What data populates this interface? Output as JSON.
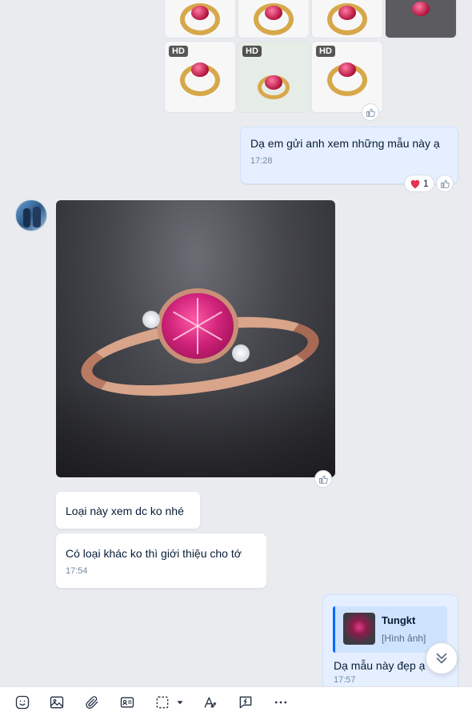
{
  "messages": {
    "out_1": {
      "text": "Dạ em gửi anh xem những mẫu này ạ",
      "time": "17:28",
      "reaction_count": "1"
    },
    "in_1": {
      "text": "Loại này xem dc ko nhé"
    },
    "in_2": {
      "text": "Có loại khác ko thì giới thiệu cho tớ",
      "time": "17:54"
    },
    "out_2": {
      "quote_name": "Tungkt",
      "quote_sub": "[Hình ảnh]",
      "text": "Dạ mẫu này đẹp ạ",
      "time": "17:57"
    }
  },
  "thumbs": {
    "hd_label": "HD"
  },
  "icons": {
    "like": "thumbs-up-icon",
    "heart": "heart-icon",
    "scroll": "double-chevron-down-icon"
  },
  "colors": {
    "accent": "#0068ff",
    "out_bubble": "#e5efff",
    "in_bubble": "#ffffff",
    "heart": "#e6304f"
  }
}
